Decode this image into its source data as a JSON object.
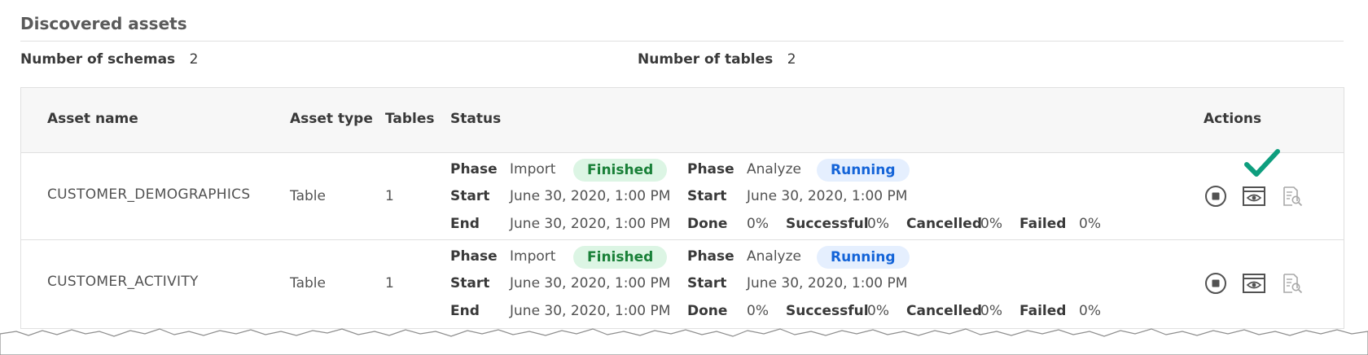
{
  "section": {
    "title": "Discovered assets",
    "schemas_label": "Number of schemas",
    "schemas_value": "2",
    "tables_label": "Number of tables",
    "tables_value": "2"
  },
  "table": {
    "columns": {
      "asset_name": "Asset name",
      "asset_type": "Asset type",
      "tables": "Tables",
      "status": "Status",
      "actions": "Actions"
    },
    "status_labels": {
      "phase": "Phase",
      "start": "Start",
      "end": "End",
      "done": "Done",
      "successful": "Successful",
      "cancelled": "Cancelled",
      "failed": "Failed"
    },
    "rows": [
      {
        "name": "CUSTOMER_DEMOGRAPHICS",
        "type": "Table",
        "tables": "1",
        "import_phase": "Import",
        "import_status": "Finished",
        "import_start": "June 30, 2020, 1:00 PM",
        "import_end": "June 30, 2020, 1:00 PM",
        "analyze_phase": "Analyze",
        "analyze_status": "Running",
        "analyze_start": "June 30, 2020, 1:00 PM",
        "done": "0%",
        "successful": "0%",
        "cancelled": "0%",
        "failed": "0%"
      },
      {
        "name": "CUSTOMER_ACTIVITY",
        "type": "Table",
        "tables": "1",
        "import_phase": "Import",
        "import_status": "Finished",
        "import_start": "June 30, 2020, 1:00 PM",
        "import_end": "June 30, 2020, 1:00 PM",
        "analyze_phase": "Analyze",
        "analyze_status": "Running",
        "analyze_start": "June 30, 2020, 1:00 PM",
        "done": "0%",
        "successful": "0%",
        "cancelled": "0%",
        "failed": "0%"
      }
    ]
  },
  "icons": {
    "stop": "stop-icon",
    "view": "view-icon",
    "inspect": "document-search-icon",
    "checkmark": "checkmark-icon"
  },
  "colors": {
    "finished_bg": "#dcf5e4",
    "finished_text": "#198038",
    "running_bg": "#e5effe",
    "running_text": "#1464d8",
    "checkmark": "#0e9e7e"
  }
}
